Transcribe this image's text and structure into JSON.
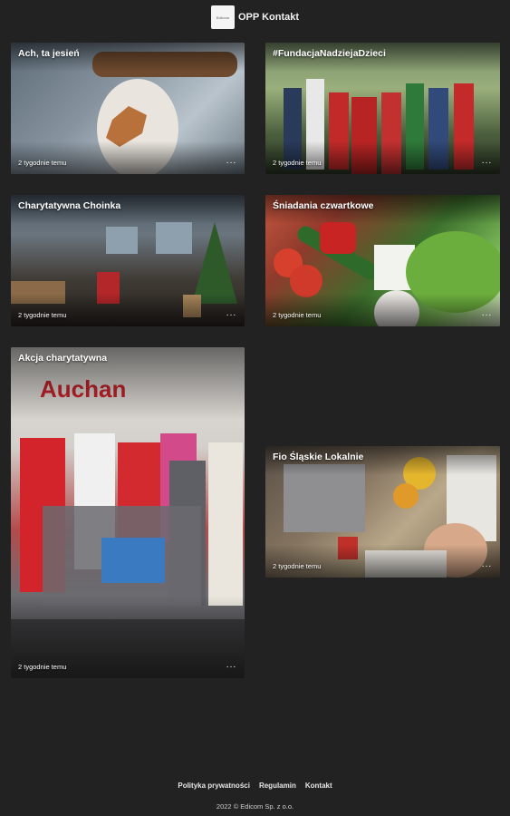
{
  "header": {
    "brand": "OPP Kontakt",
    "logo_text": "Edicom"
  },
  "cards": [
    {
      "title": "Ach, ta jesień",
      "time": "2 tygodnie temu",
      "more": "···"
    },
    {
      "title": "#FundacjaNadziejaDzieci",
      "time": "2 tygodnie temu",
      "more": "···"
    },
    {
      "title": "Charytatywna Choinka",
      "time": "2 tygodnie temu",
      "more": "···"
    },
    {
      "title": "Śniadania czwartkowe",
      "time": "2 tygodnie temu",
      "more": "···"
    },
    {
      "title": "Akcja charytatywna",
      "time": "2 tygodnie temu",
      "more": "···"
    },
    {
      "title": "Fio Śląskie Lokalnie",
      "time": "2 tygodnie temu",
      "more": "···"
    }
  ],
  "footer": {
    "links": [
      "Polityka prywatności",
      "Regulamin",
      "Kontakt"
    ],
    "copyright": "2022 © Edicom Sp. z o.o."
  }
}
